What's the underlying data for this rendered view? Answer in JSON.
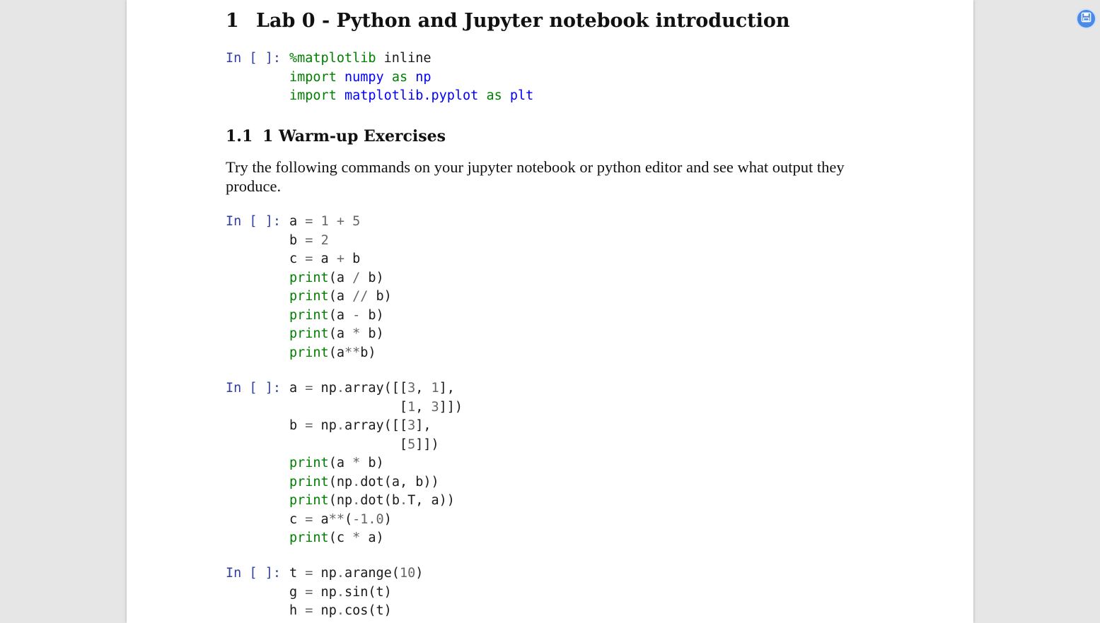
{
  "document": {
    "section": {
      "number": "1",
      "title": "Lab 0 - Python and Jupyter notebook introduction"
    },
    "subsection": {
      "number": "1.1",
      "title": "1 Warm-up Exercises"
    },
    "paragraph": "Try the following commands on your jupyter notebook or python editor and see what output they produce."
  },
  "cells": [
    {
      "prompt": "In [ ]:",
      "lines": [
        [
          [
            "kw",
            "%matplotlib"
          ],
          [
            "txt",
            " inline"
          ]
        ],
        [
          [
            "kw",
            "import"
          ],
          [
            "txt",
            " "
          ],
          [
            "mod",
            "numpy"
          ],
          [
            "txt",
            " "
          ],
          [
            "kw",
            "as"
          ],
          [
            "txt",
            " "
          ],
          [
            "mod",
            "np"
          ]
        ],
        [
          [
            "kw",
            "import"
          ],
          [
            "txt",
            " "
          ],
          [
            "mod",
            "matplotlib.pyplot"
          ],
          [
            "txt",
            " "
          ],
          [
            "kw",
            "as"
          ],
          [
            "txt",
            " "
          ],
          [
            "mod",
            "plt"
          ]
        ]
      ]
    },
    {
      "prompt": "In [ ]:",
      "lines": [
        [
          [
            "txt",
            "a "
          ],
          [
            "op",
            "="
          ],
          [
            "txt",
            " "
          ],
          [
            "num",
            "1"
          ],
          [
            "txt",
            " "
          ],
          [
            "op",
            "+"
          ],
          [
            "txt",
            " "
          ],
          [
            "num",
            "5"
          ]
        ],
        [
          [
            "txt",
            "b "
          ],
          [
            "op",
            "="
          ],
          [
            "txt",
            " "
          ],
          [
            "num",
            "2"
          ]
        ],
        [
          [
            "txt",
            "c "
          ],
          [
            "op",
            "="
          ],
          [
            "txt",
            " a "
          ],
          [
            "op",
            "+"
          ],
          [
            "txt",
            " b"
          ]
        ],
        [
          [
            "fn",
            "print"
          ],
          [
            "txt",
            "(a "
          ],
          [
            "op",
            "/"
          ],
          [
            "txt",
            " b)"
          ]
        ],
        [
          [
            "fn",
            "print"
          ],
          [
            "txt",
            "(a "
          ],
          [
            "op",
            "//"
          ],
          [
            "txt",
            " b)"
          ]
        ],
        [
          [
            "fn",
            "print"
          ],
          [
            "txt",
            "(a "
          ],
          [
            "op",
            "-"
          ],
          [
            "txt",
            " b)"
          ]
        ],
        [
          [
            "fn",
            "print"
          ],
          [
            "txt",
            "(a "
          ],
          [
            "op",
            "*"
          ],
          [
            "txt",
            " b)"
          ]
        ],
        [
          [
            "fn",
            "print"
          ],
          [
            "txt",
            "(a"
          ],
          [
            "op",
            "**"
          ],
          [
            "txt",
            "b)"
          ]
        ]
      ]
    },
    {
      "prompt": "In [ ]:",
      "lines": [
        [
          [
            "txt",
            "a "
          ],
          [
            "op",
            "="
          ],
          [
            "txt",
            " np"
          ],
          [
            "op",
            "."
          ],
          [
            "txt",
            "array([["
          ],
          [
            "num",
            "3"
          ],
          [
            "txt",
            ", "
          ],
          [
            "num",
            "1"
          ],
          [
            "txt",
            "],"
          ]
        ],
        [
          [
            "txt",
            "              ["
          ],
          [
            "num",
            "1"
          ],
          [
            "txt",
            ", "
          ],
          [
            "num",
            "3"
          ],
          [
            "txt",
            "]])"
          ]
        ],
        [
          [
            "txt",
            "b "
          ],
          [
            "op",
            "="
          ],
          [
            "txt",
            " np"
          ],
          [
            "op",
            "."
          ],
          [
            "txt",
            "array([["
          ],
          [
            "num",
            "3"
          ],
          [
            "txt",
            "],"
          ]
        ],
        [
          [
            "txt",
            "              ["
          ],
          [
            "num",
            "5"
          ],
          [
            "txt",
            "]])"
          ]
        ],
        [
          [
            "fn",
            "print"
          ],
          [
            "txt",
            "(a "
          ],
          [
            "op",
            "*"
          ],
          [
            "txt",
            " b)"
          ]
        ],
        [
          [
            "fn",
            "print"
          ],
          [
            "txt",
            "(np"
          ],
          [
            "op",
            "."
          ],
          [
            "txt",
            "dot(a, b))"
          ]
        ],
        [
          [
            "fn",
            "print"
          ],
          [
            "txt",
            "(np"
          ],
          [
            "op",
            "."
          ],
          [
            "txt",
            "dot(b"
          ],
          [
            "op",
            "."
          ],
          [
            "txt",
            "T, a))"
          ]
        ],
        [
          [
            "txt",
            "c "
          ],
          [
            "op",
            "="
          ],
          [
            "txt",
            " a"
          ],
          [
            "op",
            "**"
          ],
          [
            "txt",
            "("
          ],
          [
            "op",
            "-"
          ],
          [
            "num",
            "1.0"
          ],
          [
            "txt",
            ")"
          ]
        ],
        [
          [
            "fn",
            "print"
          ],
          [
            "txt",
            "(c "
          ],
          [
            "op",
            "*"
          ],
          [
            "txt",
            " a)"
          ]
        ]
      ]
    },
    {
      "prompt": "In [ ]:",
      "lines": [
        [
          [
            "txt",
            "t "
          ],
          [
            "op",
            "="
          ],
          [
            "txt",
            " np"
          ],
          [
            "op",
            "."
          ],
          [
            "txt",
            "arange("
          ],
          [
            "num",
            "10"
          ],
          [
            "txt",
            ")"
          ]
        ],
        [
          [
            "txt",
            "g "
          ],
          [
            "op",
            "="
          ],
          [
            "txt",
            " np"
          ],
          [
            "op",
            "."
          ],
          [
            "txt",
            "sin(t)"
          ]
        ],
        [
          [
            "txt",
            "h "
          ],
          [
            "op",
            "="
          ],
          [
            "txt",
            " np"
          ],
          [
            "op",
            "."
          ],
          [
            "txt",
            "cos(t)"
          ]
        ]
      ]
    }
  ],
  "toolbar": {
    "save_icon": "save-icon",
    "accent": "#4a8ae6"
  }
}
